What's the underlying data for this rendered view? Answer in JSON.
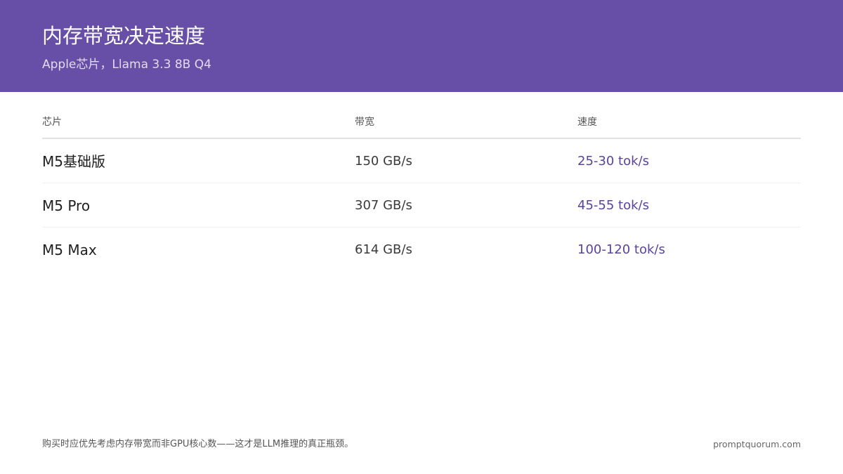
{
  "header": {
    "title": "内存带宽决定速度",
    "subtitle": "Apple芯片，Llama 3.3 8B Q4"
  },
  "table": {
    "columns": [
      "芯片",
      "带宽",
      "速度"
    ],
    "rows": [
      {
        "chip": "M5基础版",
        "bandwidth": "150 GB/s",
        "speed": "25-30 tok/s"
      },
      {
        "chip": "M5 Pro",
        "bandwidth": "307 GB/s",
        "speed": "45-55 tok/s"
      },
      {
        "chip": "M5 Max",
        "bandwidth": "614 GB/s",
        "speed": "100-120 tok/s"
      }
    ]
  },
  "footer": {
    "note": "购买时应优先考虑内存带宽而非GPU核心数——这才是LLM推理的真正瓶颈。",
    "site": "promptquorum.com"
  },
  "colors": {
    "header_bg": "#674ea6",
    "accent": "#5a42a0"
  }
}
